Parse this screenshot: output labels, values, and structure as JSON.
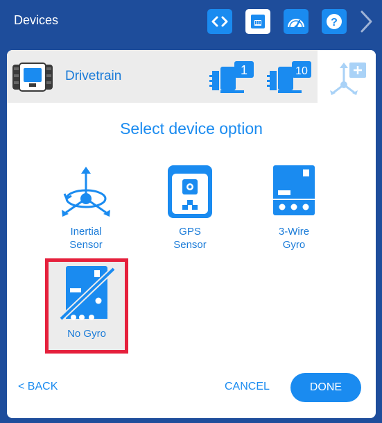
{
  "header": {
    "title": "Devices",
    "buttons": [
      {
        "name": "code",
        "icon": "code-brackets-icon"
      },
      {
        "name": "devices",
        "icon": "brain-port-icon",
        "active": true
      },
      {
        "name": "dashboard",
        "icon": "gauge-icon"
      },
      {
        "name": "help",
        "icon": "help-icon"
      }
    ]
  },
  "panel": {
    "device_name": "Drivetrain",
    "motor_badges": [
      "1",
      "10"
    ],
    "title": "Select device option",
    "options": [
      {
        "label_line1": "Inertial",
        "label_line2": "Sensor",
        "icon": "inertial-sensor-icon"
      },
      {
        "label_line1": "GPS",
        "label_line2": "Sensor",
        "icon": "gps-sensor-icon"
      },
      {
        "label_line1": "3-Wire",
        "label_line2": "Gyro",
        "icon": "three-wire-gyro-icon"
      },
      {
        "label_line1": "No Gyro",
        "label_line2": "",
        "icon": "no-gyro-icon",
        "selected": true
      }
    ]
  },
  "footer": {
    "back_label": "< BACK",
    "cancel_label": "CANCEL",
    "done_label": "DONE"
  },
  "colors": {
    "header_bg": "#1e4d9b",
    "accent": "#1a8bf0",
    "selection": "#e5203c"
  }
}
